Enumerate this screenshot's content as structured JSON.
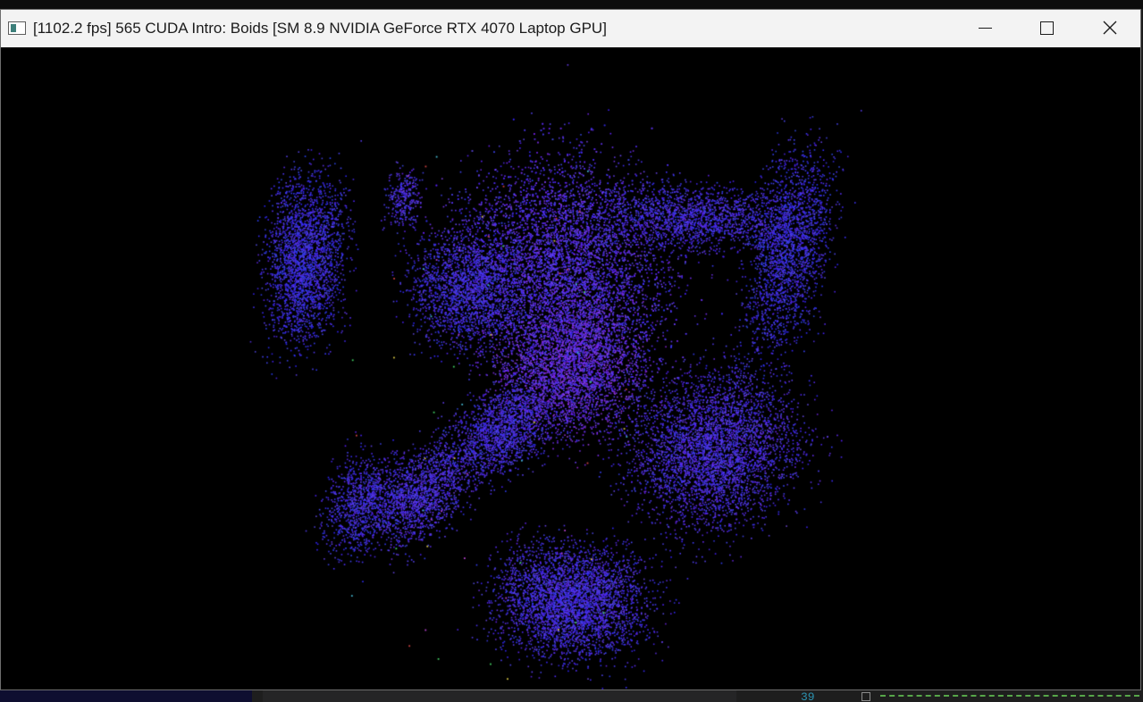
{
  "window": {
    "title": "[1102.2 fps] 565 CUDA Intro: Boids [SM 8.9 NVIDIA GeForce RTX 4070 Laptop GPU]",
    "controls": {
      "minimize_icon": "minimize-icon",
      "maximize_icon": "maximize-icon",
      "close_icon": "close-icon"
    }
  },
  "background_editor": {
    "visible_line_number": "39"
  },
  "simulation": {
    "description_colors": {
      "primary": "#3a30f0",
      "secondary": "#5a48e8",
      "accent_purple": "#8a3ad8",
      "accent_cyan": "#40b0c8",
      "background": "#000000"
    }
  }
}
